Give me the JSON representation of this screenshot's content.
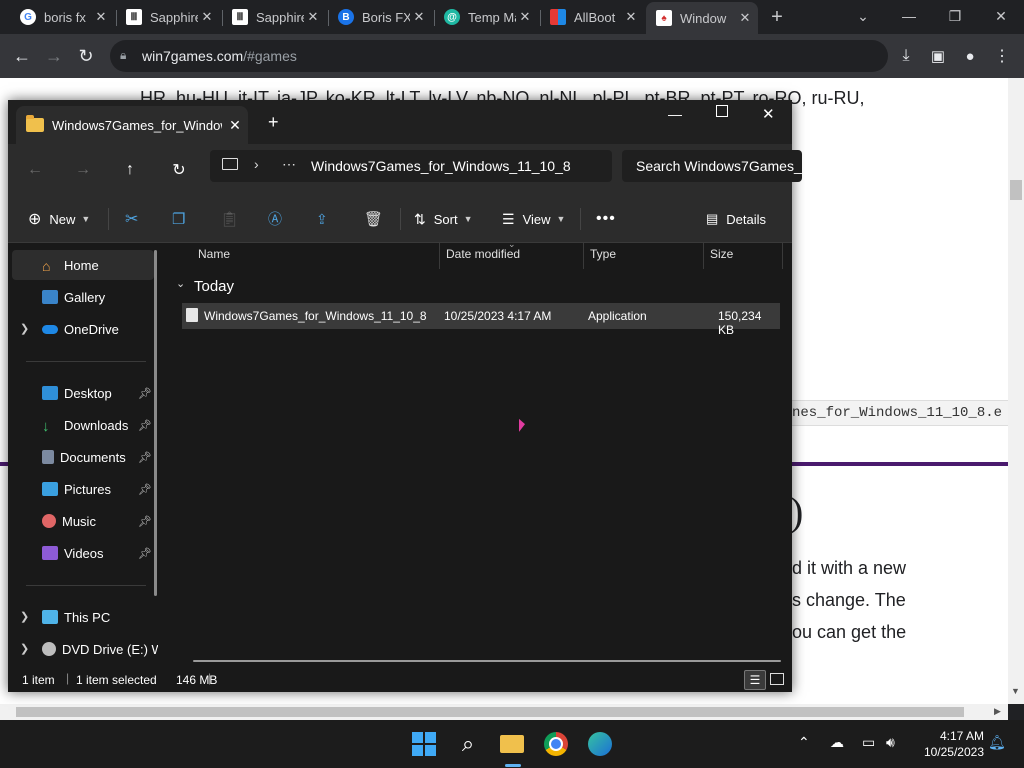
{
  "browser": {
    "tabs": [
      {
        "label": "boris fx",
        "icon": "google-icon"
      },
      {
        "label": "Sapphire",
        "icon": "museum-icon"
      },
      {
        "label": "Sapphire",
        "icon": "museum-icon"
      },
      {
        "label": "Boris FX",
        "icon": "borisfx-icon"
      },
      {
        "label": "Temp Mail",
        "icon": "tempmail-icon"
      },
      {
        "label": "AllBoot",
        "icon": "allboot-icon"
      },
      {
        "label": "Window",
        "icon": "cards-icon"
      }
    ],
    "url_host": "win7games.com",
    "url_path": "/#games"
  },
  "webpage": {
    "lang_line": "HR, hu-HU, it-IT, ja-JP, ko-KR, lt-LT, lv-LV, nb-NO, nl-NL, pl-PL, pt-BR, pt-PT, ro-RO, ru-RU,",
    "code_fragment": "nes_for_Windows_11_10_8.e",
    "heading_fragment": ")",
    "para1": "d it with a new",
    "para2": "s change. The",
    "para3": "ou can get the"
  },
  "explorer": {
    "tab_title": "Windows7Games_for_Window",
    "address": "Windows7Games_for_Windows_11_10_8",
    "search_placeholder": "Search Windows7Games_",
    "commands": {
      "new": "New",
      "sort": "Sort",
      "view": "View",
      "details": "Details"
    },
    "nav": {
      "home": "Home",
      "gallery": "Gallery",
      "onedrive": "OneDrive",
      "desktop": "Desktop",
      "downloads": "Downloads",
      "documents": "Documents",
      "pictures": "Pictures",
      "music": "Music",
      "videos": "Videos",
      "thispc": "This PC",
      "dvd": "DVD Drive (E:) W"
    },
    "columns": {
      "name": "Name",
      "date": "Date modified",
      "type": "Type",
      "size": "Size"
    },
    "group": "Today",
    "file": {
      "name": "Windows7Games_for_Windows_11_10_8",
      "date": "10/25/2023 4:17 AM",
      "type": "Application",
      "size": "150,234 KB"
    },
    "status": {
      "count": "1 item",
      "selected": "1 item selected",
      "size": "146 MB"
    }
  },
  "taskbar": {
    "time": "4:17 AM",
    "date": "10/25/2023"
  }
}
